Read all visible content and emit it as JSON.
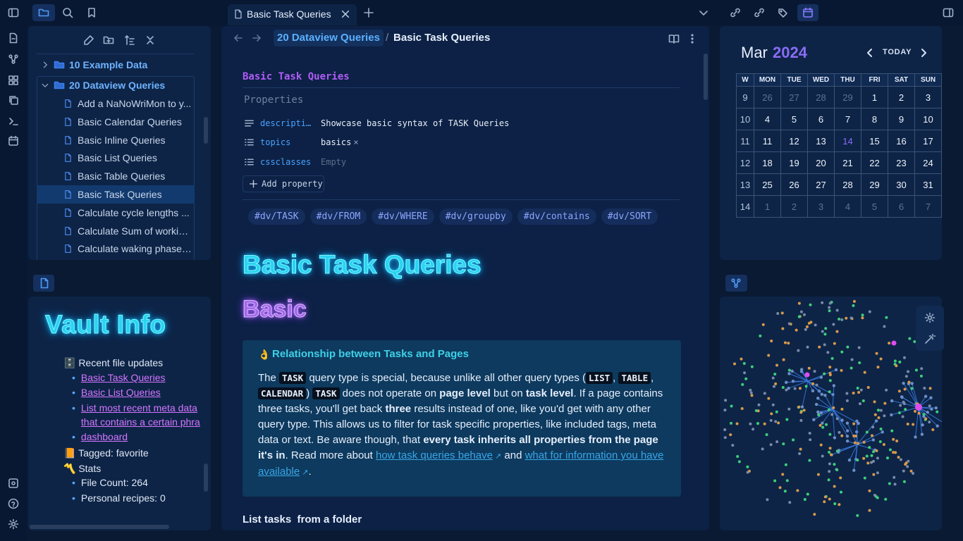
{
  "tab": {
    "title": "Basic Task Queries"
  },
  "breadcrumb": {
    "parent": "20 Dataview Queries",
    "sep": "/",
    "current": "Basic Task Queries"
  },
  "file_tree": {
    "folders": [
      {
        "label": "10 Example Data"
      },
      {
        "label": "20 Dataview Queries"
      }
    ],
    "files": [
      "Add a NaNoWriMon to y...",
      "Basic Calendar Queries",
      "Basic Inline Queries",
      "Basic List Queries",
      "Basic Table Queries",
      "Basic Task Queries",
      "Calculate cycle lengths ...",
      "Calculate Sum of workin...",
      "Calculate waking phase ..."
    ]
  },
  "note": {
    "inline_title": "Basic Task Queries",
    "properties_heading": "Properties",
    "properties": [
      {
        "key": "descripti…",
        "value": "Showcase basic syntax of TASK Queries",
        "icon": "text-icon"
      },
      {
        "key": "topics",
        "value": "basics",
        "remove": "×",
        "icon": "list-icon"
      },
      {
        "key": "cssclasses",
        "value": "Empty",
        "icon": "list-icon"
      }
    ],
    "add_property": "Add property",
    "tags": [
      "#dv/TASK",
      "#dv/FROM",
      "#dv/WHERE",
      "#dv/groupby",
      "#dv/contains",
      "#dv/SORT"
    ],
    "h1": "Basic Task Queries",
    "h2": "Basic",
    "callout": {
      "icon": "👌",
      "title": "Relationship between Tasks and Pages",
      "p_the": "The",
      "c_task": "TASK",
      "p1": "query type is special, because unlike all other query types (",
      "c_list": "LIST",
      "comma": ",",
      "c_table": "TABLE",
      "c_calendar": "CALENDAR",
      "paren": ")",
      "c_task2": "TASK",
      "p2": "does not operate on",
      "b_page": "page level",
      "p3": "but on",
      "b_task": "task level",
      "p4": ". If a page contains three tasks, you'll get back",
      "b_three": "three",
      "p5": "results instead of one, like you'd get with any other query type. This allows us to filter for task specific properties, like included tags, meta data or text. Be aware though, that",
      "b_inherit": "every task inherits all properties from the page it's in",
      "p6": ". Read more about",
      "link1": "how task queries behave",
      "and": "and",
      "link2": "what for information you have available",
      "end": "."
    },
    "h3": "List tasks  from a folder"
  },
  "vault_info": {
    "title": "Vault Info",
    "recent_label": "🗄️ Recent file updates",
    "recent": [
      "Basic Task Queries",
      "Basic List Queries",
      "List most recent meta data",
      "that contains a certain phra",
      "dashboard"
    ],
    "tagged": "📙 Tagged: favorite",
    "stats_label": "〽️ Stats",
    "stats": [
      "File Count: 264",
      "Personal recipes: 0"
    ]
  },
  "calendar": {
    "month": "Mar",
    "year": "2024",
    "today_label": "TODAY",
    "headers": [
      "W",
      "MON",
      "TUE",
      "WED",
      "THU",
      "FRI",
      "SAT",
      "SUN"
    ],
    "weeks": [
      {
        "w": "9",
        "days": [
          "26",
          "27",
          "28",
          "29",
          "1",
          "2",
          "3"
        ],
        "dim": [
          0,
          1,
          2,
          3
        ]
      },
      {
        "w": "10",
        "days": [
          "4",
          "5",
          "6",
          "7",
          "8",
          "9",
          "10"
        ],
        "dim": []
      },
      {
        "w": "11",
        "days": [
          "11",
          "12",
          "13",
          "14",
          "15",
          "16",
          "17"
        ],
        "dim": [],
        "today": 3
      },
      {
        "w": "12",
        "days": [
          "18",
          "19",
          "20",
          "21",
          "22",
          "23",
          "24"
        ],
        "dim": []
      },
      {
        "w": "13",
        "days": [
          "25",
          "26",
          "27",
          "28",
          "29",
          "30",
          "31"
        ],
        "dim": []
      },
      {
        "w": "14",
        "days": [
          "1",
          "2",
          "3",
          "4",
          "5",
          "6",
          "7"
        ],
        "dim": [
          0,
          1,
          2,
          3,
          4,
          5,
          6
        ]
      }
    ]
  },
  "colors": {
    "accent": "#7c6cf0",
    "link": "#3aa6e8",
    "neon_cyan": "#29d4f0",
    "neon_purple": "#a06be8",
    "graph_orange": "#d99a4a",
    "graph_green": "#3ecf7a",
    "graph_blue": "#4a8ef5"
  }
}
